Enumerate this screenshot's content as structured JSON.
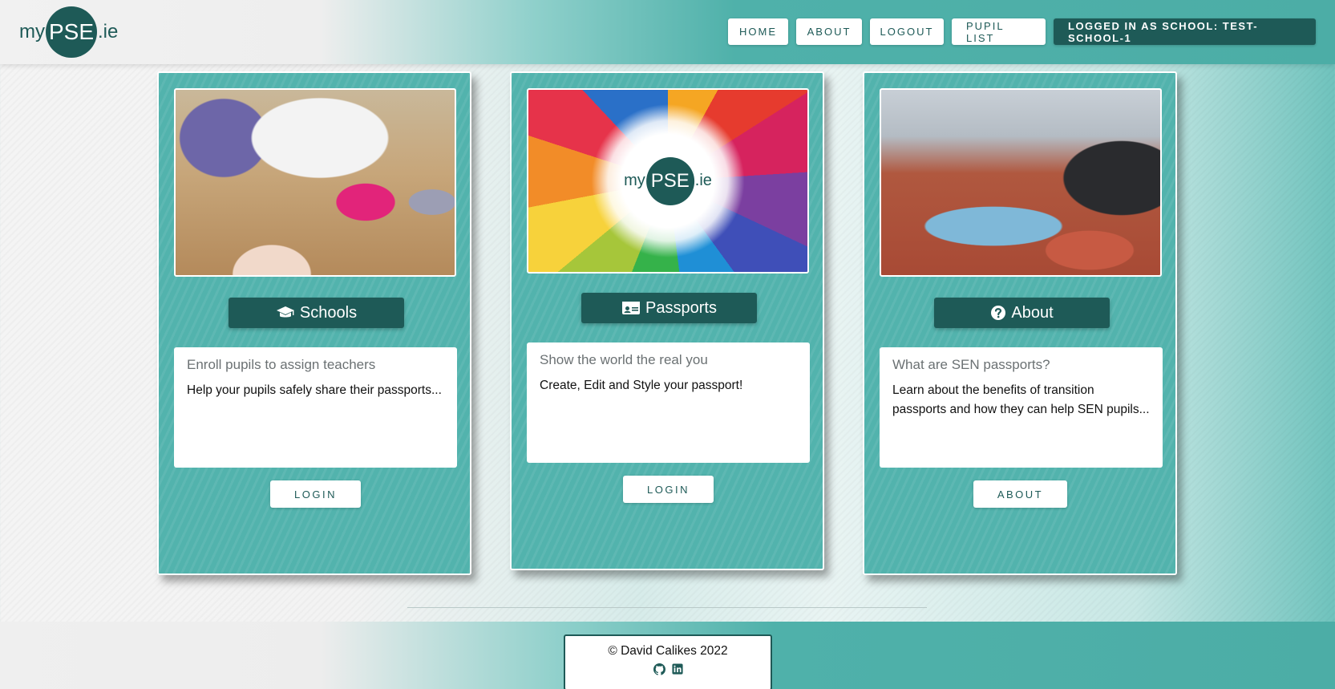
{
  "header": {
    "logo": {
      "my": "my",
      "pse": "PSE",
      "ie": ".ie"
    },
    "nav": {
      "home": "HOME",
      "about": "ABOUT",
      "logout": "LOGOUT",
      "pupil_list": "PUPIL LIST",
      "status": "LOGGED IN AS SCHOOL: TEST-SCHOOL-1"
    }
  },
  "cards": [
    {
      "button_label": "Schools",
      "icon": "graduation-cap-icon",
      "subtitle": "Enroll pupils to assign teachers",
      "body": "Help your pupils safely share their passports...",
      "action_label": "LOGIN"
    },
    {
      "button_label": "Passports",
      "icon": "id-card-icon",
      "subtitle": "Show the world the real you",
      "body": "Create, Edit and Style your passport!",
      "action_label": "LOGIN"
    },
    {
      "button_label": "About",
      "icon": "question-circle-icon",
      "subtitle": "What are SEN passports?",
      "body": "Learn about the benefits of transition passports and how they can help SEN pupils...",
      "action_label": "ABOUT"
    }
  ],
  "footer": {
    "copyright": "© David Calikes 2022",
    "icons": [
      "github-icon",
      "linkedin-icon"
    ]
  },
  "colors": {
    "brand_dark": "#1e5a57",
    "card_teal": "#52b3ad"
  }
}
